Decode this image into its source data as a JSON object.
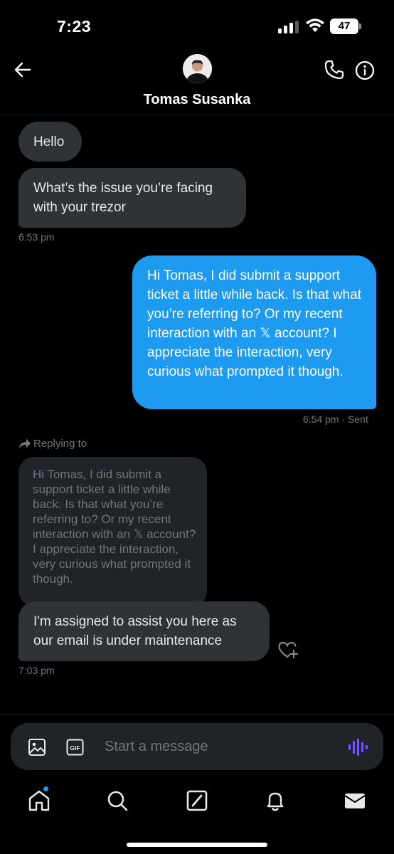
{
  "status_bar": {
    "time": "7:23",
    "battery": "47"
  },
  "header": {
    "contact_name": "Tomas Susanka"
  },
  "messages": {
    "hello": "Hello",
    "issue": "What’s the issue you’re facing with your trezor",
    "timestamp_1": "6:53 pm",
    "outgoing": "Hi Tomas, I did submit a support ticket a little while back. Is that what you’re referring to? Or my recent interaction with an 𝕏 account? I appreciate the interaction, very curious what prompted it though.",
    "timestamp_2": "6:54 pm · Sent",
    "reply_label": "Replying to",
    "reply_quote": "Hi Tomas, I did submit a support ticket a little while back. Is that what you’re referring to? Or my recent interaction with an 𝕏 account? I appreciate the interaction, very curious what prompted it though.",
    "assigned": "I'm assigned to assist you here as our email is under maintenance",
    "timestamp_3": "7:03 pm"
  },
  "compose": {
    "placeholder": "Start a message",
    "gif_label": "GIF"
  },
  "icons": {
    "back": "arrow-left-icon",
    "phone": "phone-icon",
    "info": "info-icon",
    "media": "image-icon",
    "gif": "gif-icon",
    "voice": "voice-wave-icon",
    "react": "heart-plus-icon",
    "home": "home-icon",
    "search": "search-icon",
    "grok": "grok-icon",
    "notifications": "bell-icon",
    "messages": "envelope-icon"
  },
  "colors": {
    "accent": "#1d9bf0",
    "incoming_bubble": "#2f3336",
    "voice": "#7856ff"
  }
}
